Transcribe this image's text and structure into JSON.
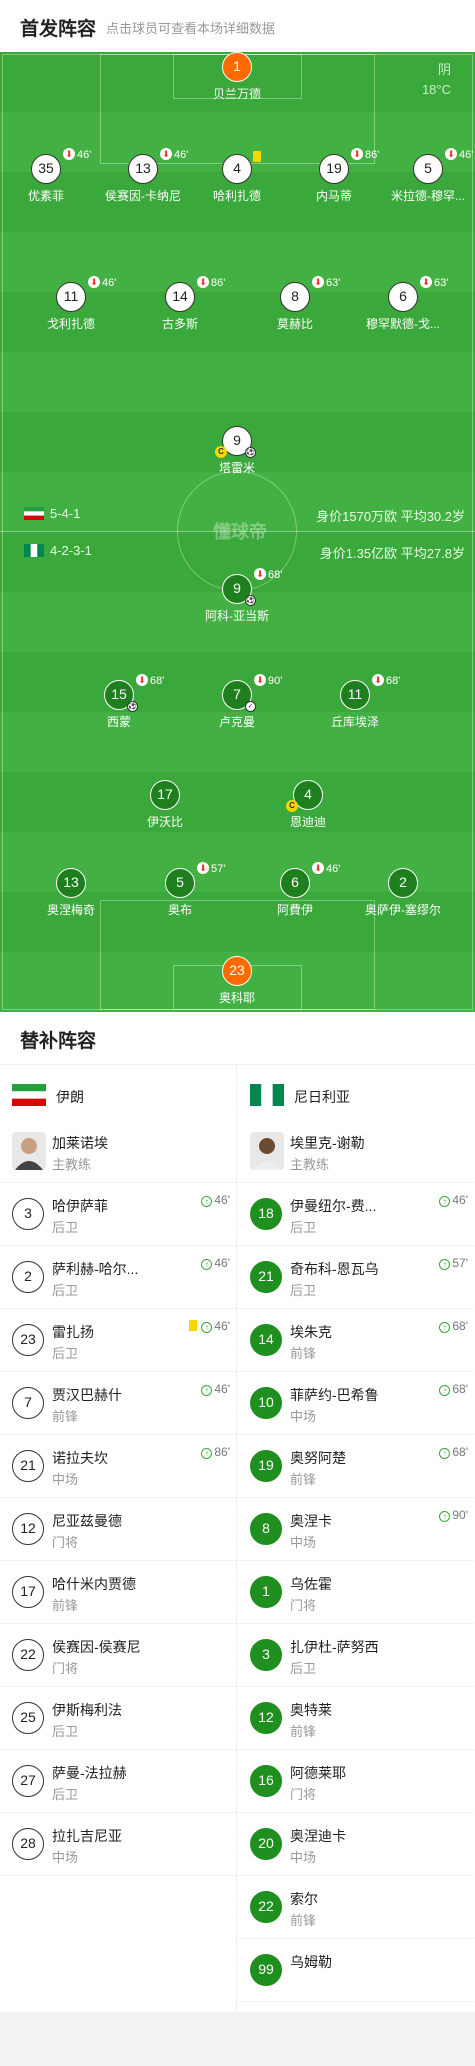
{
  "header": {
    "title": "首发阵容",
    "subtitle": "点击球员可查看本场详细数据"
  },
  "weather": {
    "cond": "阴",
    "temp": "18°C"
  },
  "watermark": "懂球帝",
  "home": {
    "formation": "5-4-1",
    "value": "身价1570万欧",
    "age": "平均30.2岁",
    "colors": [
      "#239f40",
      "#ffffff",
      "#da0000"
    ]
  },
  "away": {
    "formation": "4-2-3-1",
    "value": "身价1.35亿欧",
    "age": "平均27.8岁",
    "colors": [
      "#008751",
      "#ffffff",
      "#008751"
    ]
  },
  "home_players": [
    {
      "num": "1",
      "name": "贝兰万德",
      "gk": true
    },
    {
      "num": "35",
      "name": "优素菲",
      "sub": "46'"
    },
    {
      "num": "13",
      "name": "侯赛因-卡纳尼",
      "sub": "46'"
    },
    {
      "num": "4",
      "name": "哈利扎德",
      "yellow": true
    },
    {
      "num": "19",
      "name": "内马蒂",
      "sub": "86'"
    },
    {
      "num": "5",
      "name": "米拉德-穆罕...",
      "sub": "46'"
    },
    {
      "num": "11",
      "name": "戈利扎德",
      "sub": "46'"
    },
    {
      "num": "14",
      "name": "古多斯",
      "sub": "86'"
    },
    {
      "num": "8",
      "name": "莫赫比",
      "sub": "63'"
    },
    {
      "num": "6",
      "name": "穆罕默德-戈...",
      "sub": "63'"
    },
    {
      "num": "9",
      "name": "塔雷米",
      "cap": true,
      "goal": true
    }
  ],
  "away_players": [
    {
      "num": "9",
      "name": "阿科-亚当斯",
      "sub": "68'",
      "goal": true
    },
    {
      "num": "15",
      "name": "西蒙",
      "sub": "68'",
      "goal": true
    },
    {
      "num": "7",
      "name": "卢克曼",
      "sub": "90'",
      "assist": true
    },
    {
      "num": "11",
      "name": "丘库埃泽",
      "sub": "68'"
    },
    {
      "num": "17",
      "name": "伊沃比"
    },
    {
      "num": "4",
      "name": "恩迪迪",
      "cap": true
    },
    {
      "num": "13",
      "name": "奥涅梅奇"
    },
    {
      "num": "5",
      "name": "奥布",
      "sub": "57'"
    },
    {
      "num": "6",
      "name": "阿費伊",
      "sub": "46'"
    },
    {
      "num": "2",
      "name": "奥萨伊-塞缪尔"
    },
    {
      "num": "23",
      "name": "奥科耶",
      "gk": true
    }
  ],
  "subs_title": "替补阵容",
  "home_team": {
    "name": "伊朗"
  },
  "away_team": {
    "name": "尼日利亚"
  },
  "home_subs": [
    {
      "num": "",
      "name": "加莱诺埃",
      "pos": "主教练",
      "coach": true
    },
    {
      "num": "3",
      "name": "哈伊萨菲",
      "pos": "后卫",
      "sm": "46'"
    },
    {
      "num": "2",
      "name": "萨利赫-哈尔...",
      "pos": "后卫",
      "sm": "46'"
    },
    {
      "num": "23",
      "name": "雷扎扬",
      "pos": "后卫",
      "sm": "46'",
      "yellow": true
    },
    {
      "num": "7",
      "name": "贾汉巴赫什",
      "pos": "前锋",
      "sm": "46'"
    },
    {
      "num": "21",
      "name": "诺拉夫坎",
      "pos": "中场",
      "sm": "86'"
    },
    {
      "num": "12",
      "name": "尼亚兹曼德",
      "pos": "门将"
    },
    {
      "num": "17",
      "name": "哈什米内贾德",
      "pos": "前锋"
    },
    {
      "num": "22",
      "name": "侯赛因-侯赛尼",
      "pos": "门将"
    },
    {
      "num": "25",
      "name": "伊斯梅利法",
      "pos": "后卫"
    },
    {
      "num": "27",
      "name": "萨曼-法拉赫",
      "pos": "后卫"
    },
    {
      "num": "28",
      "name": "拉扎吉尼亚",
      "pos": "中场"
    }
  ],
  "away_subs": [
    {
      "num": "",
      "name": "埃里克-谢勒",
      "pos": "主教练",
      "coach": true
    },
    {
      "num": "18",
      "name": "伊曼纽尔-费...",
      "pos": "后卫",
      "sm": "46'"
    },
    {
      "num": "21",
      "name": "奇布科-恩瓦乌",
      "pos": "后卫",
      "sm": "57'"
    },
    {
      "num": "14",
      "name": "埃朱克",
      "pos": "前锋",
      "sm": "68'"
    },
    {
      "num": "10",
      "name": "菲萨约-巴希鲁",
      "pos": "中场",
      "sm": "68'"
    },
    {
      "num": "19",
      "name": "奥努阿楚",
      "pos": "前锋",
      "sm": "68'"
    },
    {
      "num": "8",
      "name": "奥涅卡",
      "pos": "中场",
      "sm": "90'"
    },
    {
      "num": "1",
      "name": "乌佐霍",
      "pos": "门将"
    },
    {
      "num": "3",
      "name": "扎伊杜-萨努西",
      "pos": "后卫"
    },
    {
      "num": "12",
      "name": "奥特莱",
      "pos": "前锋"
    },
    {
      "num": "16",
      "name": "阿德莱耶",
      "pos": "门将"
    },
    {
      "num": "20",
      "name": "奥涅迪卡",
      "pos": "中场"
    },
    {
      "num": "22",
      "name": "索尔",
      "pos": "前锋"
    },
    {
      "num": "99",
      "name": "乌姆勒",
      "pos": ""
    }
  ]
}
